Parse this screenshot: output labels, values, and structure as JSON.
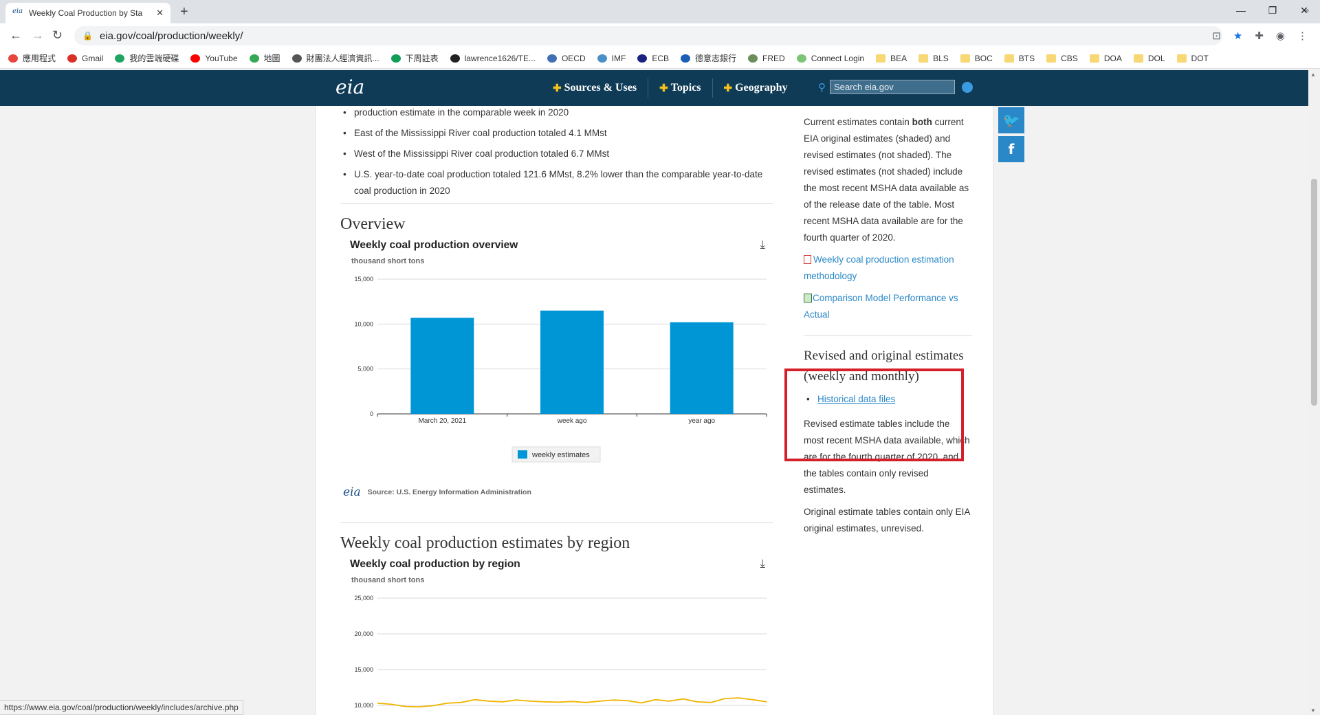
{
  "browser": {
    "tab_title": "Weekly Coal Production by Sta",
    "url": "eia.gov/coal/production/weekly/",
    "status_url": "https://www.eia.gov/coal/production/weekly/includes/archive.php",
    "bookmarks": [
      {
        "label": "應用程式",
        "color": "#e8453c"
      },
      {
        "label": "Gmail",
        "color": "#d93025"
      },
      {
        "label": "我的雲端硬碟",
        "color": "#1fa463"
      },
      {
        "label": "YouTube",
        "color": "#ff0000"
      },
      {
        "label": "地圖",
        "color": "#34a853"
      },
      {
        "label": "財團法人經濟資訊...",
        "color": "#555555"
      },
      {
        "label": "下周註表",
        "color": "#0f9d58"
      },
      {
        "label": "lawrence1626/TE...",
        "color": "#222222"
      },
      {
        "label": "OECD",
        "color": "#3f6fb5"
      },
      {
        "label": "IMF",
        "color": "#4a90c8"
      },
      {
        "label": "ECB",
        "color": "#1a237e"
      },
      {
        "label": "德意志銀行",
        "color": "#1a5fb4"
      },
      {
        "label": "FRED",
        "color": "#6b8e5a"
      },
      {
        "label": "Connect Login",
        "color": "#7cc576"
      },
      {
        "label": "BEA",
        "folder": true
      },
      {
        "label": "BLS",
        "folder": true
      },
      {
        "label": "BOC",
        "folder": true
      },
      {
        "label": "BTS",
        "folder": true
      },
      {
        "label": "CBS",
        "folder": true
      },
      {
        "label": "DOA",
        "folder": true
      },
      {
        "label": "DOL",
        "folder": true
      },
      {
        "label": "DOT",
        "folder": true
      }
    ]
  },
  "site": {
    "logo": "eia",
    "nav": [
      "Sources & Uses",
      "Topics",
      "Geography"
    ],
    "search_placeholder": "Search eia.gov"
  },
  "main": {
    "bullets": [
      "production estimate in the comparable week in 2020",
      "East of the Mississippi River coal production totaled 4.1 MMst",
      "West of the Mississippi River coal production totaled 6.7 MMst",
      "U.S. year-to-date coal production totaled 121.6 MMst, 8.2% lower than the comparable year-to-date coal production in 2020"
    ],
    "overview_heading": "Overview",
    "region_heading": "Weekly coal production estimates by region",
    "source_note": "Source: U.S. Energy Information Administration"
  },
  "chart_data": [
    {
      "type": "bar",
      "title": "Weekly coal production overview",
      "ylabel": "thousand short tons",
      "categories": [
        "March 20, 2021",
        "week ago",
        "year ago"
      ],
      "series": [
        {
          "name": "weekly estimates",
          "values": [
            10700,
            11500,
            10200
          ]
        }
      ],
      "ylim": [
        0,
        15000
      ],
      "yticks": [
        0,
        5000,
        10000,
        15000
      ],
      "ytick_labels": [
        "0",
        "5,000",
        "10,000",
        "15,000"
      ],
      "grid": true,
      "legend": "bottom",
      "color": "#0096d6"
    },
    {
      "type": "line",
      "title": "Weekly coal production by region",
      "ylabel": "thousand short tons",
      "yticks": [
        10000,
        15000,
        20000,
        25000
      ],
      "ytick_labels": [
        "10,000",
        "15,000",
        "20,000",
        "25,000"
      ],
      "ylim": [
        10000,
        25000
      ],
      "grid": true,
      "series": [
        {
          "values": [
            10300,
            10150,
            9850,
            9800,
            9950,
            10300,
            10400,
            10800,
            10600,
            10500,
            10750,
            10600,
            10500,
            10450,
            10550,
            10400,
            10600,
            10750,
            10650,
            10350,
            10800,
            10600,
            10900,
            10500,
            10400,
            10950,
            11050,
            10800,
            10500
          ]
        }
      ],
      "color": "#f0b400"
    }
  ],
  "sidebar": {
    "current_text_pre": "Current estimates contain ",
    "current_text_bold": "both",
    "current_text_post": " current EIA original estimates (shaded) and revised estimates (not shaded). The revised estimates (not shaded) include the most recent MSHA data available as of the release date of the table. Most recent MSHA data available are for the fourth quarter of 2020.",
    "link_methodology": "Weekly coal production estimation methodology",
    "link_comparison": "Comparison Model Performance vs Actual",
    "revised_heading": "Revised and original estimates (weekly and monthly)",
    "historical_link": "Historical data files",
    "revised_text": "Revised estimate tables include the most recent MSHA data available, which are for the fourth quarter of 2020, and the tables contain only revised estimates.",
    "original_text": "Original estimate tables contain only EIA original estimates, unrevised."
  }
}
